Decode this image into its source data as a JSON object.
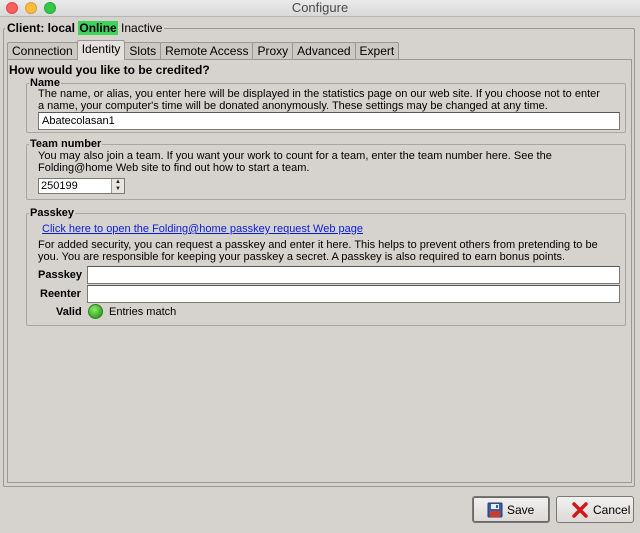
{
  "window": {
    "title": "Configure"
  },
  "client": {
    "prefix": "Client: local",
    "status_online": "Online",
    "status_text": "Inactive"
  },
  "tabs": [
    {
      "label": "Connection"
    },
    {
      "label": "Identity",
      "active": true
    },
    {
      "label": "Slots"
    },
    {
      "label": "Remote Access"
    },
    {
      "label": "Proxy"
    },
    {
      "label": "Advanced"
    },
    {
      "label": "Expert"
    }
  ],
  "identity": {
    "heading": "How would you like to be credited?",
    "name_group": {
      "legend": "Name",
      "desc_line1": "The name, or alias, you enter here will be displayed in the statistics page on our web site.  If you choose not to enter",
      "desc_line2": "a name, your computer's time will be donated anonymously.  These settings may be changed at any time.",
      "value": "Abatecolasan1"
    },
    "team_group": {
      "legend": "Team number",
      "desc_line1": "You may also join a team.  If you want your work to count for a team, enter the team number here.  See the",
      "desc_line2": "Folding@home Web site to find out how to start a team.",
      "value": "250199"
    },
    "passkey_group": {
      "legend": "Passkey",
      "link": "Click here to open the Folding@home passkey request Web page",
      "desc_line1": "For added security, you can request a passkey and enter it here.  This helps to prevent others from pretending to be",
      "desc_line2": "you.  You are responsible for keeping your passkey a secret.  A passkey is also required to earn bonus points.",
      "passkey_label": "Passkey",
      "passkey_value": "",
      "reenter_label": "Reenter",
      "reenter_value": "",
      "valid_label": "Valid",
      "valid_status": "Entries match"
    }
  },
  "buttons": {
    "save": "Save",
    "cancel": "Cancel"
  },
  "colors": {
    "online": "#3fd35a",
    "link": "#0a1dd8",
    "valid": "#3fb22c"
  }
}
